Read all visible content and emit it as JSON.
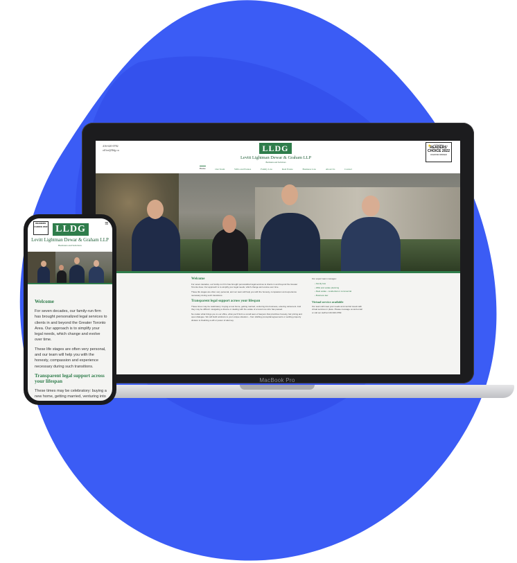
{
  "device": {
    "laptop_label": "MacBook Pro"
  },
  "site": {
    "phone": "416-620-0782",
    "email": "office@lldg.ca",
    "logo": "LLDG",
    "name": "Levitt Lightman Dewar & Graham LLP",
    "tagline": "Barristers and Solicitors",
    "award": {
      "top": "insideHalton",
      "main": "READERS' CHOICE 2022",
      "bottom": "DIAMOND WINNER"
    },
    "nav": [
      "Home",
      "Our Team",
      "Wills and Estates",
      "Family Law",
      "Real Estate",
      "Business Law",
      "About Us",
      "Contact"
    ],
    "content": {
      "welcome_heading": "Welcome",
      "welcome_p1": "For seven decades, our family-run firm has brought personalized legal services to clients in and beyond the Greater Toronto Area. Our approach is to simplify your legal needs, which change and evolve over time.",
      "welcome_p2": "These life stages are often very personal, and our team will help you with the honesty, compassion and experience necessary during such transitions.",
      "transparent_heading": "Transparent legal support across your lifespan",
      "transparent_p1": "These times may be celebratory: buying a new home, getting married, venturing into business, entering retirement. And they may be difficult: navigating a divorce or dealing with the estate of a loved one who has passed.",
      "transparent_p2": "No matter what brings you to our office, what you'll find is a small team of lawyers that prioritizes honesty, fair pricing and open dialogue. We will build solutions to your unique situation – from drafting prenuptial agreements or settling property division to finalizing a will or power of attorney.",
      "expert_intro": "Our expert team manages:",
      "services": [
        "Family law",
        "Wills and estate planning",
        "Real estate - residential or commercial",
        "Business law"
      ],
      "virtual_heading": "Virtual service available",
      "virtual_p": "Our team will meet your needs and comfort levels with virtual services in place. Please message us and email or call our staff at 416-620-0782."
    }
  },
  "mobile": {
    "award": "READERS' CHOICE 2022",
    "menu_icon": "≡",
    "welcome_heading": "Welcome",
    "welcome_p1": "For seven decades, our family-run firm has brought personalized legal services to clients in and beyond the Greater Toronto Area. Our approach is to simplify your legal needs, which change and evolve over time.",
    "welcome_p2": "These life stages are often very personal, and our team will help you with the honesty, compassion and experience necessary during such transitions.",
    "transparent_heading": "Transparent legal support across your lifespan",
    "transparent_p1": "These times may be celebratory: buying a new home, getting married, venturing into business, entering retirement. And they may"
  },
  "colors": {
    "brand_green": "#2f7d4b",
    "blob_blue": "#3b5cf5"
  }
}
